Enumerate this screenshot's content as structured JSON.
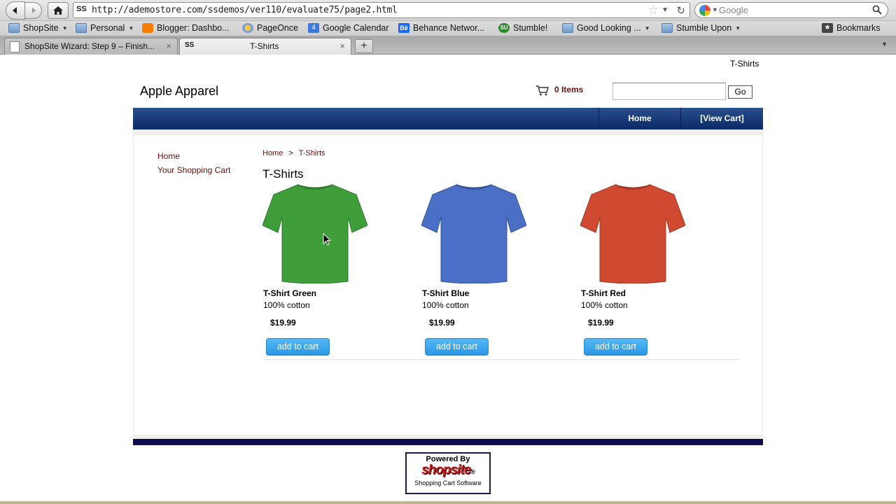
{
  "browser": {
    "url": "http://ademostore.com/ssdemos/ver110/evaluate75/page2.html",
    "url_favicon": "SS",
    "search_placeholder": "Google",
    "bookmarks": [
      {
        "label": "ShopSite",
        "icon": "folder-icon",
        "has_menu": true
      },
      {
        "label": "Personal",
        "icon": "folder-icon",
        "has_menu": true
      },
      {
        "label": "Blogger: Dashbo...",
        "icon": "blogger-icon",
        "has_menu": false
      },
      {
        "label": "PageOnce",
        "icon": "pageonce-icon",
        "has_menu": false
      },
      {
        "label": "Google Calendar",
        "icon": "calendar-icon",
        "icon_text": "4",
        "has_menu": false
      },
      {
        "label": "Behance Networ...",
        "icon": "behance-icon",
        "icon_text": "Bē",
        "has_menu": false
      },
      {
        "label": "Stumble!",
        "icon": "stumbleupon-icon",
        "icon_text": "SU",
        "has_menu": false
      },
      {
        "label": "Good Looking ...",
        "icon": "folder-icon",
        "has_menu": true
      },
      {
        "label": "Stumble Upon",
        "icon": "folder-icon",
        "has_menu": true
      }
    ],
    "bookmarks_menu": "Bookmarks",
    "tabs": [
      {
        "title": "ShopSite Wizard: Step 9 – Finish...",
        "active": false
      },
      {
        "title": "T-Shirts",
        "favicon": "SS",
        "active": true
      }
    ],
    "new_tab": "+",
    "close_glyph": "×"
  },
  "page": {
    "top_crumb": "T-Shirts",
    "store_name": "Apple Apparel",
    "cart_items": "0 Items",
    "go_label": "Go",
    "nav": {
      "home": "Home",
      "view_cart": "[View Cart]"
    },
    "sidebar": [
      "Home",
      "Your Shopping Cart"
    ],
    "breadcrumb": {
      "home": "Home",
      "sep": ">",
      "current": "T-Shirts"
    },
    "title": "T-Shirts",
    "products": [
      {
        "name": "T-Shirt Green",
        "desc": "100% cotton",
        "price": "$19.99",
        "button": "add to cart",
        "color": "#3f9e3a"
      },
      {
        "name": "T-Shirt Blue",
        "desc": "100% cotton",
        "price": "$19.99",
        "button": "add to cart",
        "color": "#4a6fc4"
      },
      {
        "name": "T-Shirt Red",
        "desc": "100% cotton",
        "price": "$19.99",
        "button": "add to cart",
        "color": "#cf4a30"
      }
    ],
    "powered": {
      "top": "Powered By",
      "brand": "shopsite",
      "reg": "®",
      "bottom": "Shopping Cart Software"
    }
  },
  "colors": {
    "accent_link": "#6b0d0d",
    "navbar": "#0b2a66",
    "button": "#2a97e4"
  }
}
